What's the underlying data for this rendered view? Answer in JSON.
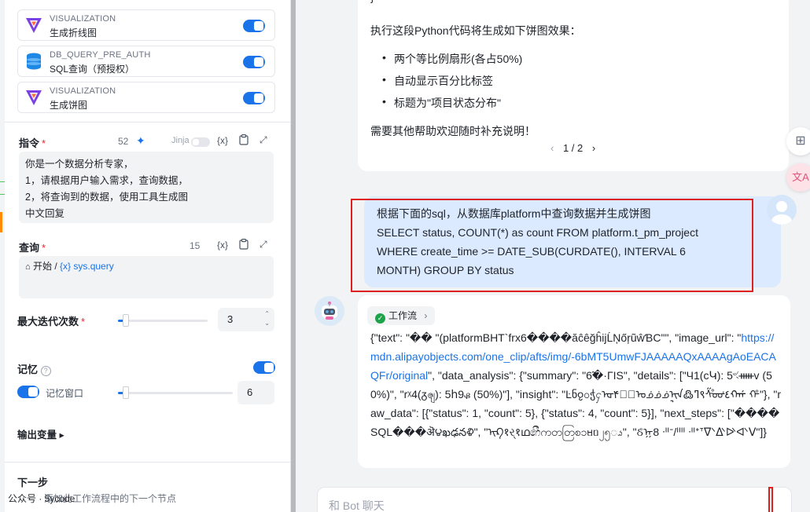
{
  "tools": [
    {
      "type": "VISUALIZATION",
      "name": "生成折线图",
      "icon": "visualization-icon",
      "enabled": true
    },
    {
      "type": "DB_QUERY_PRE_AUTH",
      "name": "SQL查询（预授权）",
      "icon": "database-icon",
      "enabled": true
    },
    {
      "type": "VISUALIZATION",
      "name": "生成饼图",
      "icon": "visualization-icon",
      "enabled": true
    }
  ],
  "instruction": {
    "label": "指令",
    "required_mark": "*",
    "count": "52",
    "jinja_label": "Jinja",
    "var_button": "{x}",
    "lines": [
      "你是一个数据分析专家，",
      "1，请根据用户输入需求，查询数据，",
      "2，将查询到的数据，使用工具生成图",
      "中文回复"
    ]
  },
  "query": {
    "label": "查询",
    "required_mark": "*",
    "count": "15",
    "var_button": "{x}",
    "start_label": "开始 /",
    "var": "{x} sys.query"
  },
  "max_iter": {
    "label": "最大迭代次数",
    "required_mark": "*",
    "value": "3"
  },
  "memory": {
    "label": "记忆",
    "window_label": "记忆窗口",
    "window_value": "6",
    "enabled": true,
    "window_enabled": true
  },
  "output_vars": {
    "label": "输出变量 ▸"
  },
  "next_step": {
    "label": "下一步"
  },
  "watermark": {
    "prefix": "公众号 · 5ycode",
    "overlay": "添加此工作流程中的下一个节点"
  },
  "assistant_top": {
    "brace": "}",
    "intro": "执行这段Python代码将生成如下饼图效果：",
    "bullets": [
      "两个等比例扇形(各占50%)",
      "自动显示百分比标签",
      "标题为\"项目状态分布\""
    ],
    "outro": "需要其他帮助欢迎随时补充说明！",
    "pager": "1 / 2"
  },
  "user_message": {
    "lines": [
      "根据下面的sql，从数据库platform中查询数据并生成饼图",
      "SELECT status, COUNT(*) as count FROM platform.t_pm_project",
      "WHERE create_time >= DATE_SUB(CURDATE(), INTERVAL 6",
      "MONTH) GROUP BY status"
    ]
  },
  "bot_reply": {
    "workflow_label": "工作流",
    "text_before_link": "{\"text\": \"�� \"(platformBHT`frx6����ăĉêğĥijĹŅőŗũŵƁCʺ\", \"image_url\": \"",
    "link": "https://mdn.alipayobjects.com/one_clip/afts/img/-6bMT5UmwFJAAAAAQxAAAAgAoEACAQFr/original",
    "text_after_link": "\", \"data_analysis\": {\"summary\": \"6̃�·ΓIS\", \"details\": [\"Ч1(сԿ): 5ৼᚔv (50%)\", \"rᵡ4(ᵹၛ): 5հ9ᏸ (50%)\"], \"insight\": \"Ŀნჹ၀ჭႁᡆکۘ۴ᠣᢻᢻᢻᠢᢩᠡ߷ߣ९ᠱ̊ᡂᡃ٤ᡣᡤ ᡥ\"}, \"raw_data\": [{\"status\": 1, \"count\": 5}, {\"status\": 4, \"count\": 5}], \"next_steps\": [\"����SQL���ऄ౪ఖఢనళి\", \"ᠢᠺ१ર્१ഥ෯ကတတြစ၁ᥛᥝ၂၅ၗ\", \"ઠ̊ᡍ8 ᐧᐦᐨ/ᐦᐦ ᐧᐦᐩᐪᐫᐬᐭᐮᐯ\"]}"
  },
  "input": {
    "placeholder": "和 Bot 聊天"
  }
}
